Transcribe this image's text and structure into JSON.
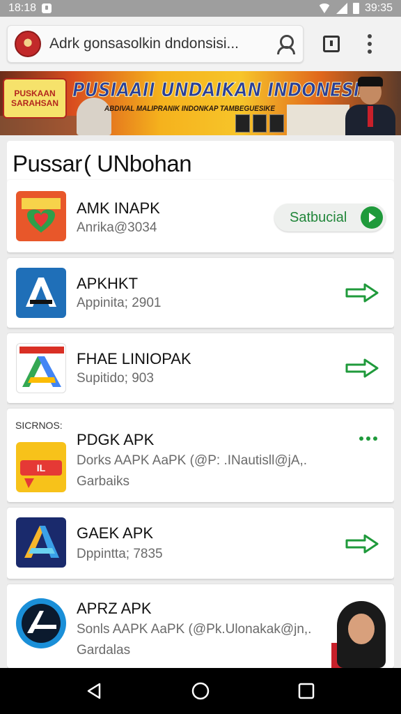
{
  "status_bar": {
    "time_left": "18:18",
    "time_right": "39:35"
  },
  "browser": {
    "url": "Adrk gonsasolkin dndonsisi..."
  },
  "banner": {
    "badge_line1": "PUSKAAN",
    "badge_line2": "SARAHSAN",
    "title": "PUSIAAII UNDAIKAN INDONESIAI",
    "subtitle": "ABDIVAL MALIPRANIK INDONKAP TAMBEGUESIKE"
  },
  "section": {
    "title": "Pussar ( UNbohan"
  },
  "apps": [
    {
      "name": "AMK INAPK",
      "meta": "Anrika@3034",
      "action": "install",
      "action_label": "Satbucial"
    },
    {
      "name": "APKHKT",
      "meta": "Appinita; 2901",
      "action": "download"
    },
    {
      "name": "FHAE LINIOPAK",
      "meta": "Supitido; 903",
      "action": "download"
    },
    {
      "tag": "SICRNOS:",
      "name": "PDGK APK",
      "meta": "Dorks AAPK AaPK (@P: .INautisll@jA,.",
      "meta2": "Garbaiks",
      "action": "more"
    },
    {
      "name": "GAEK APK",
      "meta": "Dppintta; 7835",
      "action": "download"
    },
    {
      "name": "APRZ APK",
      "meta": "Sonls AAPK AaPK (@Pk.Ulonakak@jn,.",
      "meta2": "Gardalas",
      "action": "none"
    }
  ],
  "colors": {
    "accent_green": "#1f9a3b",
    "status_bar": "#9e9e9e",
    "nav_bar": "#000000"
  },
  "icons": [
    "notification-icon",
    "wifi-icon",
    "signal-icon",
    "battery-icon",
    "profile-icon",
    "tab-switcher-icon",
    "overflow-menu-icon",
    "back-icon",
    "home-icon",
    "recents-icon"
  ]
}
